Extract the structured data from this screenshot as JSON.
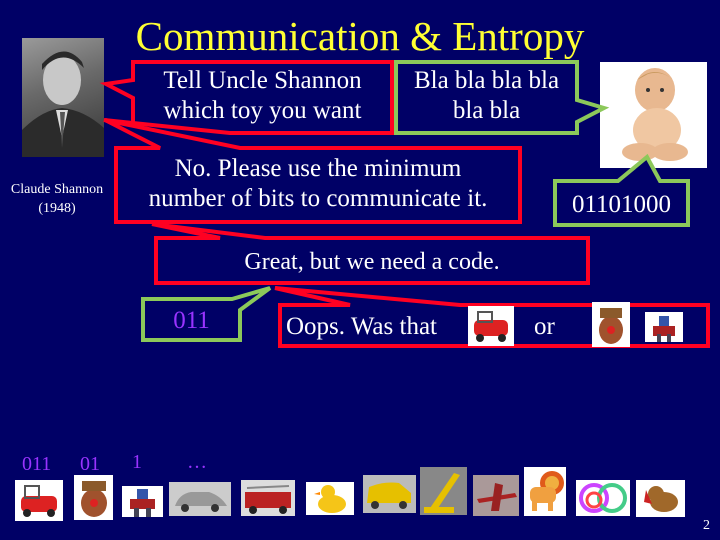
{
  "slide": {
    "title": "Communication & Entropy",
    "page_number": "2",
    "colors": {
      "background": "#000066",
      "title": "#ffff33",
      "shannon_bubble": "#ff0022",
      "baby_bubble": "#8cc85a",
      "code_text": "#9933ff"
    }
  },
  "shannon": {
    "image": "claude-shannon-portrait",
    "caption_name": "Claude Shannon",
    "caption_year": "(1948)"
  },
  "baby": {
    "image": "baby-photo"
  },
  "bubbles": {
    "b1_line1": "Tell Uncle Shannon",
    "b1_line2": "which toy you want",
    "b2_line1": "Bla bla bla bla",
    "b2_line2": "bla bla",
    "b3_line1": "No. Please use the minimum",
    "b3_line2": "number of bits to communicate it.",
    "b4_bits": "01101000",
    "b5": "Great, but we need a code.",
    "b6_code": "011",
    "b7_text": "Oops. Was that",
    "b7_or": "or",
    "b7_toy1": "red-toy-car",
    "b7_toy2": "potato-head",
    "b7_toy3": "transformer-robot"
  },
  "code_labels": [
    "011",
    "01",
    "1",
    "…"
  ],
  "toys": [
    "red-toy-car",
    "potato-head",
    "transformer-robot",
    "grey-vintage-car",
    "fire-truck",
    "rubber-duck",
    "yellow-van",
    "yellow-crane",
    "red-airplane",
    "toy-lion",
    "slinky",
    "plush-dog"
  ]
}
